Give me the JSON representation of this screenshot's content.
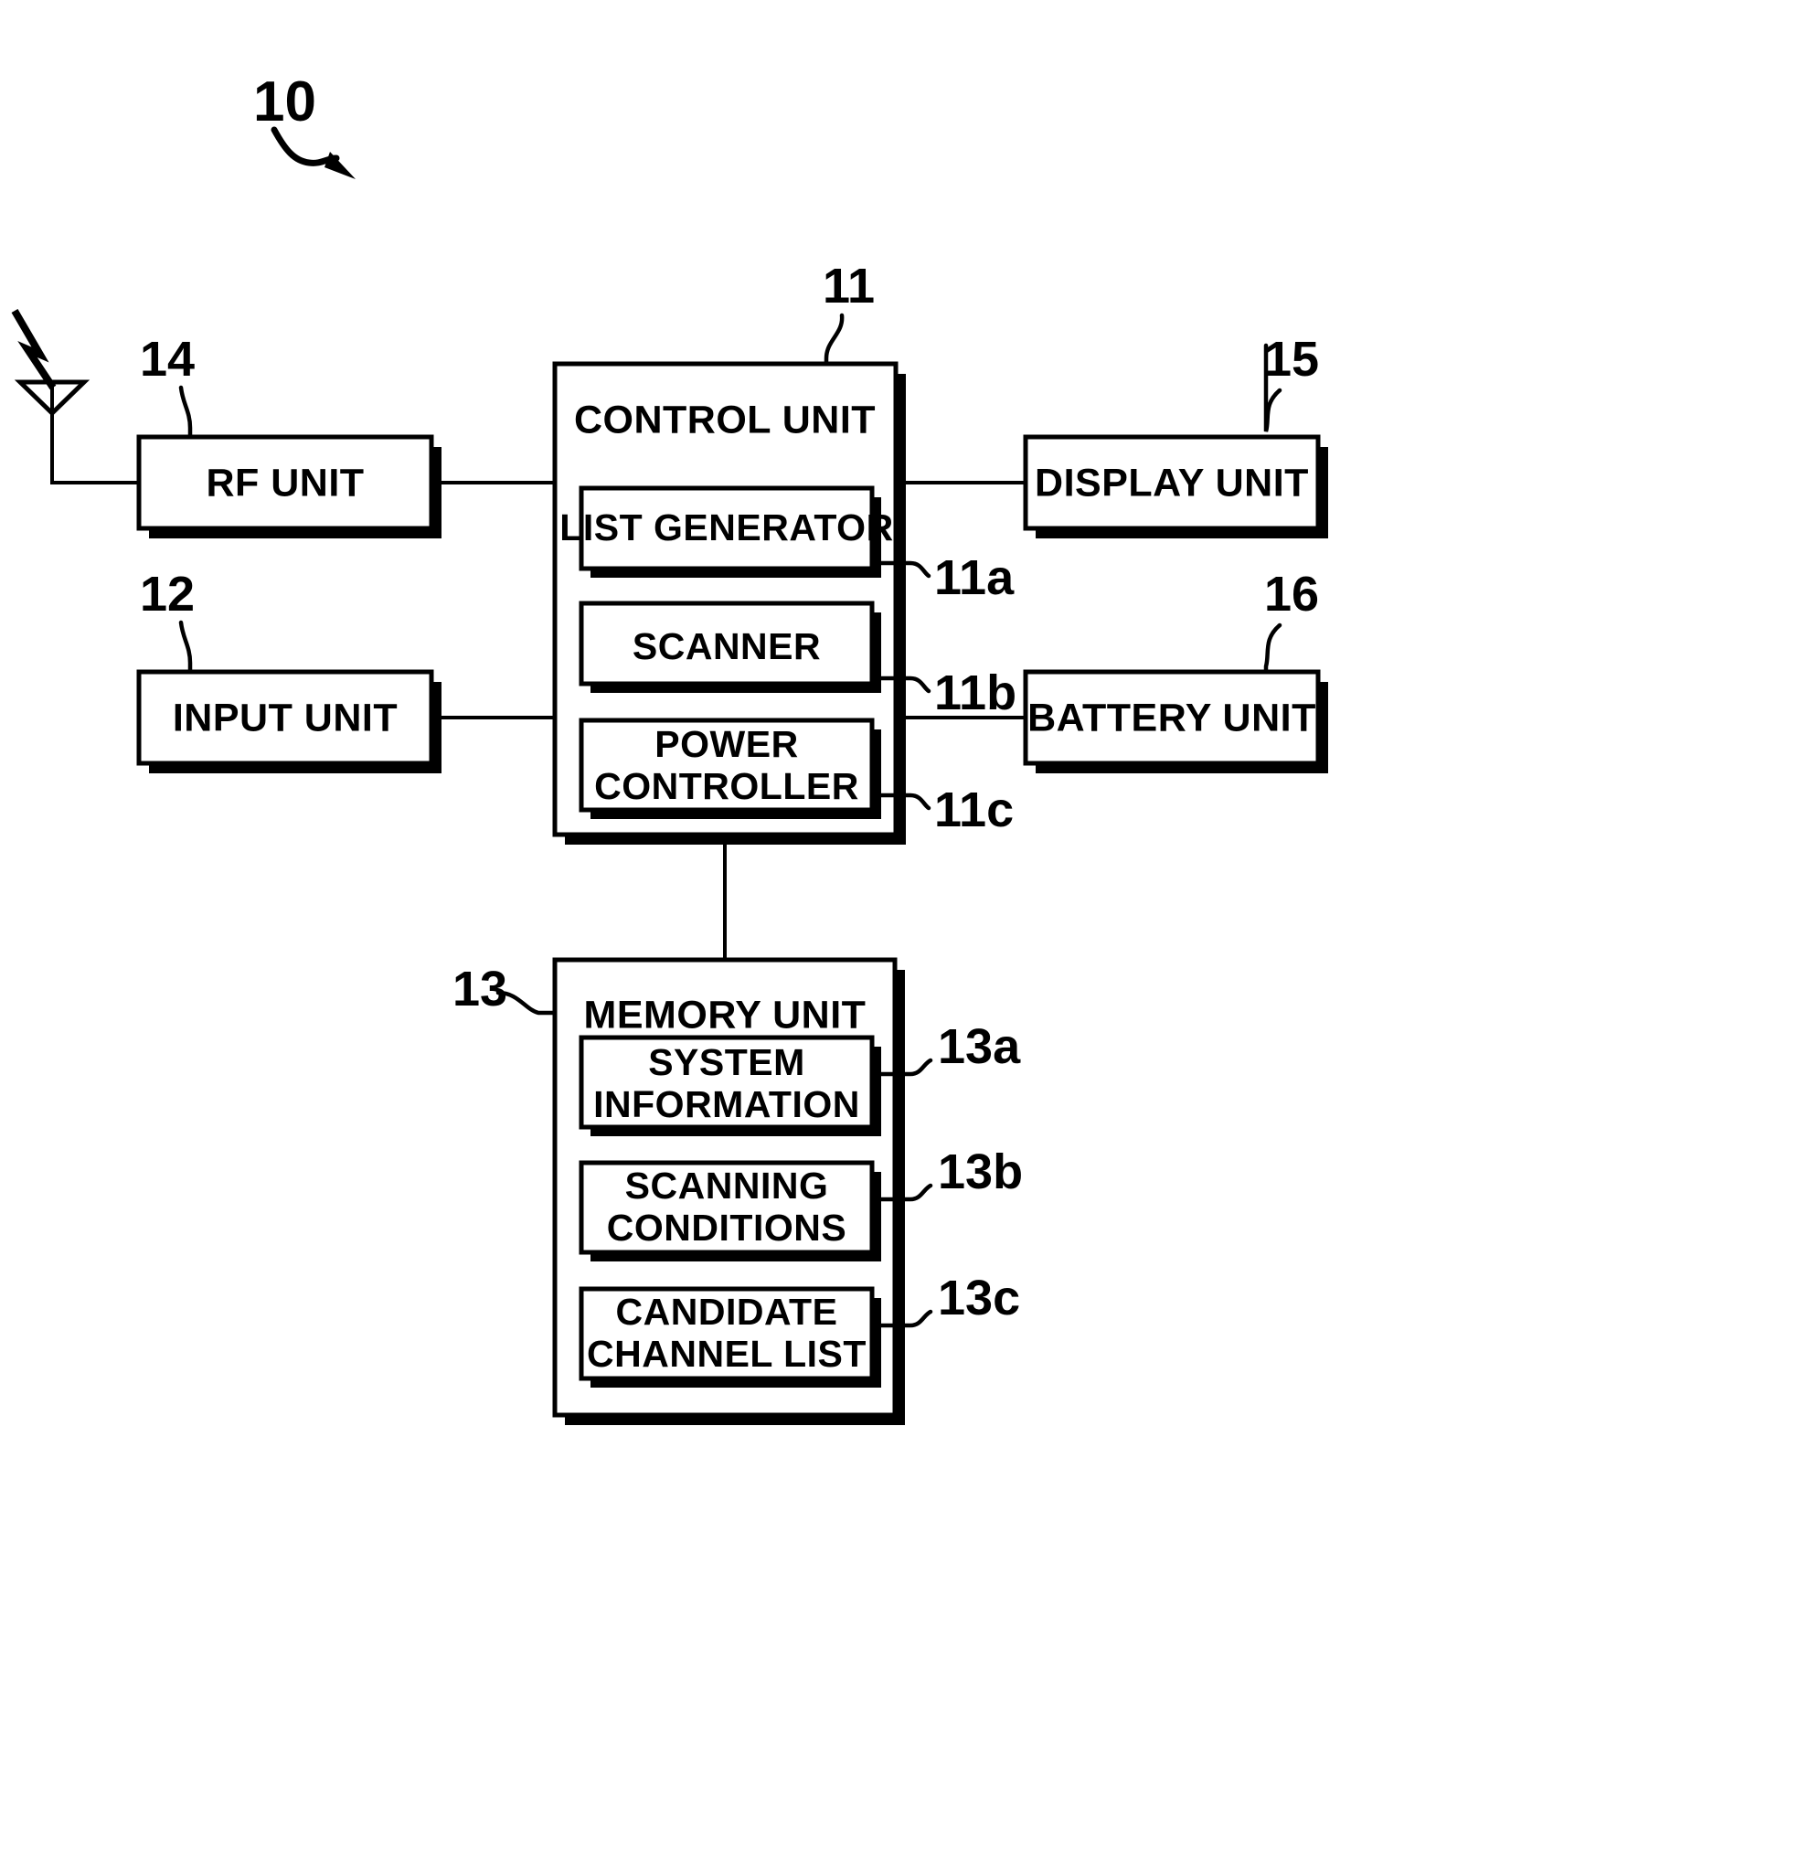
{
  "figure": {
    "reference_10": "10",
    "antenna": {
      "name": "antenna",
      "signal": "lightning-bolt"
    }
  },
  "blocks": {
    "rf_unit": {
      "label": "RF UNIT",
      "ref": "14"
    },
    "input_unit": {
      "label": "INPUT UNIT",
      "ref": "12"
    },
    "control_unit": {
      "label": "CONTROL UNIT",
      "ref": "11"
    },
    "display_unit": {
      "label": "DISPLAY UNIT",
      "ref": "15"
    },
    "battery_unit": {
      "label": "BATTERY UNIT",
      "ref": "16"
    },
    "memory_unit": {
      "label": "MEMORY UNIT",
      "ref": "13"
    }
  },
  "control_unit_children": [
    {
      "label": "LIST GENERATOR",
      "ref": "11a",
      "line1": "LIST GENERATOR",
      "line2": ""
    },
    {
      "label": "SCANNER",
      "ref": "11b",
      "line1": "SCANNER",
      "line2": ""
    },
    {
      "label": "POWER CONTROLLER",
      "ref": "11c",
      "line1": "POWER",
      "line2": "CONTROLLER"
    }
  ],
  "memory_unit_children": [
    {
      "label": "SYSTEM INFORMATION",
      "ref": "13a",
      "line1": "SYSTEM",
      "line2": "INFORMATION"
    },
    {
      "label": "SCANNING CONDITIONS",
      "ref": "13b",
      "line1": "SCANNING",
      "line2": "CONDITIONS"
    },
    {
      "label": "CANDIDATE CHANNEL LIST",
      "ref": "13c",
      "line1": "CANDIDATE",
      "line2": "CHANNEL LIST"
    }
  ],
  "colors": {
    "ink": "#000000",
    "paper": "#ffffff"
  }
}
